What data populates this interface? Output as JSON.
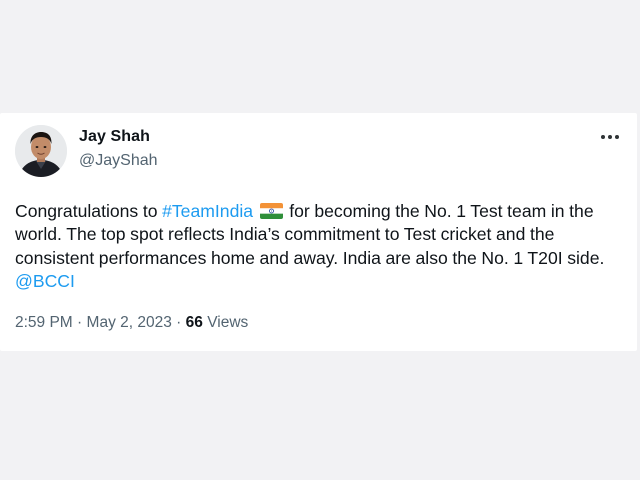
{
  "tweet": {
    "author": {
      "display_name": "Jay Shah",
      "handle": "@JayShah"
    },
    "text": {
      "part1": "Congratulations to ",
      "hashtag": "#TeamIndia",
      "flag_icon": "india-flag-icon",
      "part2": " for becoming the No. 1 Test team in the world. The top spot reflects India’s commitment to Test cricket and the consistent performances home and away. India are also the No. 1 T20I side. ",
      "mention": "@BCCI"
    },
    "meta": {
      "time": "2:59 PM",
      "separator": "·",
      "date": "May 2, 2023",
      "views_count": "66",
      "views_label": "Views"
    },
    "colors": {
      "link": "#1d9bf0",
      "text": "#0f1419",
      "secondary": "#536471",
      "background": "#f2f2f4",
      "card": "#ffffff"
    },
    "icons": {
      "more": "more-options-icon",
      "avatar": "profile-avatar"
    }
  }
}
